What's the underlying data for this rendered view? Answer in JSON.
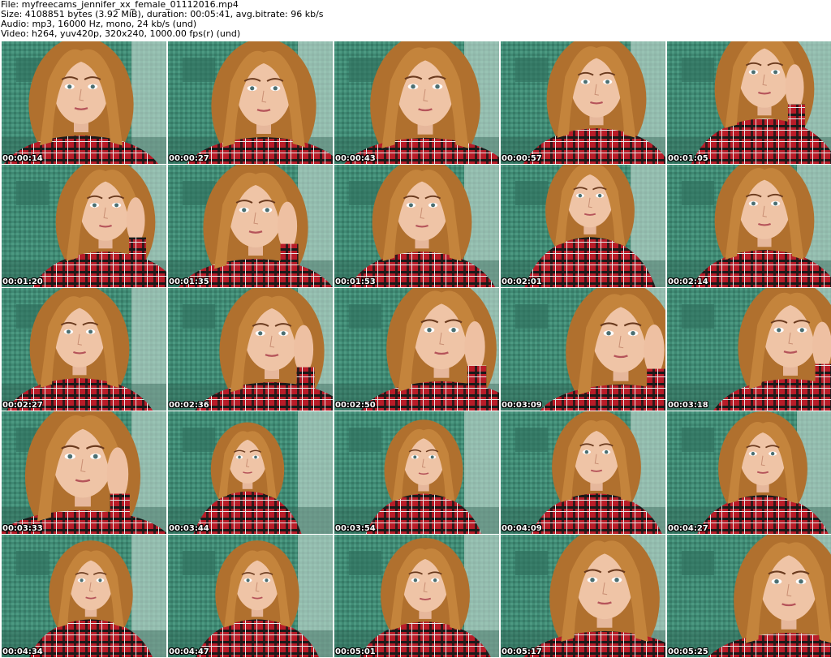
{
  "header": {
    "file": "File: myfreecams_jennifer_xx_female_01112016.mp4",
    "size": "Size: 4108851 bytes (3.92 MiB), duration: 00:05:41, avg.bitrate: 96 kb/s",
    "audio": "Audio: mp3, 16000 Hz, mono, 24 kb/s (und)",
    "video": "Video: h264, yuv420p, 320x240, 1000.00 fps(r) (und)"
  },
  "thumbnails": [
    {
      "timestamp": "00:00:14"
    },
    {
      "timestamp": "00:00:27"
    },
    {
      "timestamp": "00:00:43"
    },
    {
      "timestamp": "00:00:57"
    },
    {
      "timestamp": "00:01:05"
    },
    {
      "timestamp": "00:01:20"
    },
    {
      "timestamp": "00:01:35"
    },
    {
      "timestamp": "00:01:53"
    },
    {
      "timestamp": "00:02:01"
    },
    {
      "timestamp": "00:02:14"
    },
    {
      "timestamp": "00:02:27"
    },
    {
      "timestamp": "00:02:36"
    },
    {
      "timestamp": "00:02:50"
    },
    {
      "timestamp": "00:03:09"
    },
    {
      "timestamp": "00:03:18"
    },
    {
      "timestamp": "00:03:33"
    },
    {
      "timestamp": "00:03:44"
    },
    {
      "timestamp": "00:03:54"
    },
    {
      "timestamp": "00:04:09"
    },
    {
      "timestamp": "00:04:27"
    },
    {
      "timestamp": "00:04:34"
    },
    {
      "timestamp": "00:04:47"
    },
    {
      "timestamp": "00:05:01"
    },
    {
      "timestamp": "00:05:17"
    },
    {
      "timestamp": "00:05:25"
    }
  ]
}
